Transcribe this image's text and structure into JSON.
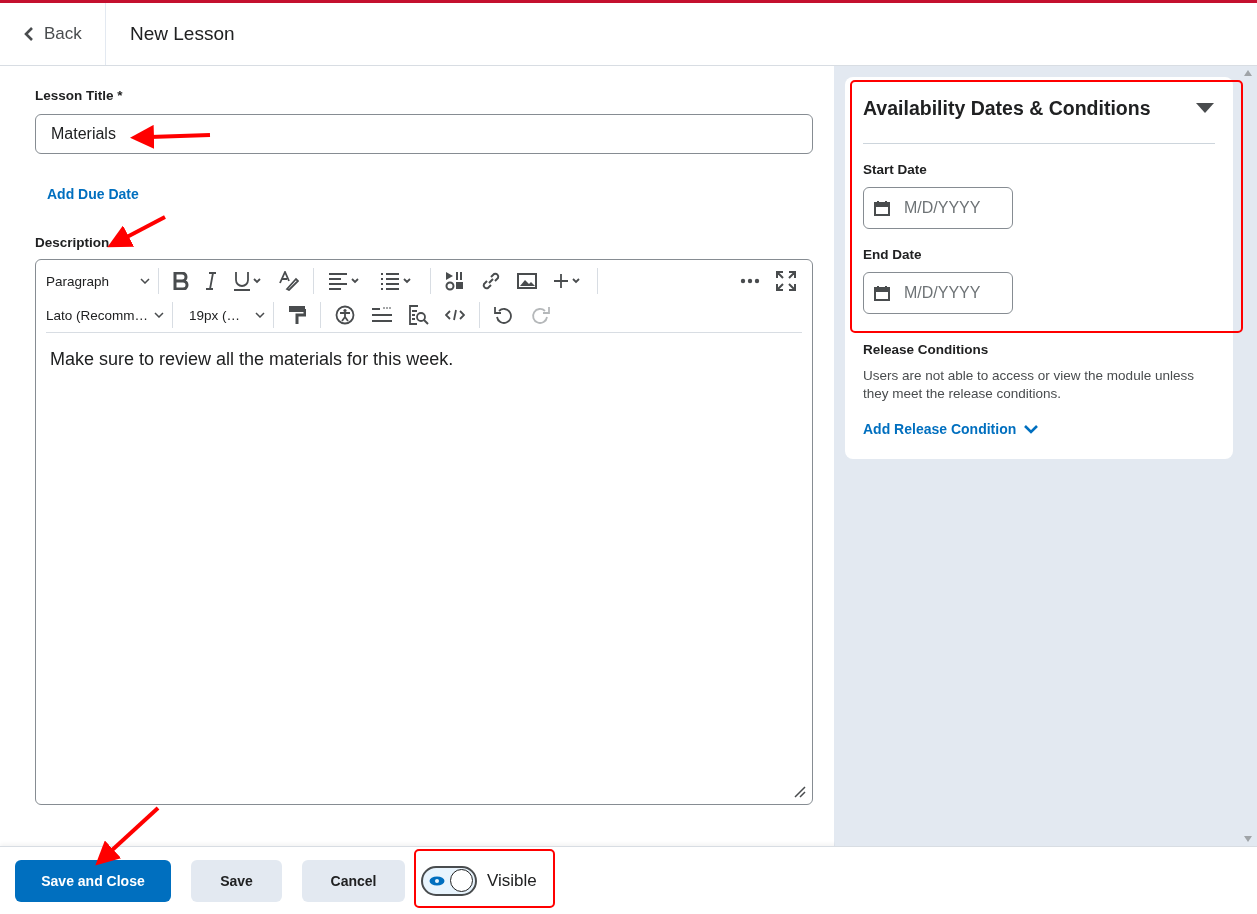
{
  "header": {
    "back": "Back",
    "title": "New Lesson"
  },
  "lesson_title": {
    "label": "Lesson Title *",
    "value": "Materials"
  },
  "add_due_date": "Add Due Date",
  "description": {
    "label": "Description",
    "toolbar_row_1": [
      {
        "kind": "dropdown",
        "label": "Paragraph"
      }
    ],
    "toolbar_row_2": [
      {
        "kind": "dropdown",
        "label": "Lato (Recomm…"
      },
      {
        "kind": "dropdown",
        "label": "19px (…"
      }
    ],
    "text": "Make sure to review all the materials for this week."
  },
  "availability": {
    "title": "Availability Dates & Conditions",
    "expanded": true,
    "fields": [
      {
        "label": "Start Date",
        "placeholder": "M/D/YYYY"
      },
      {
        "label": "End Date",
        "placeholder": "M/D/YYYY"
      }
    ],
    "release_title": "Release Conditions",
    "release_text": "Users are not able to access or view the module unless they meet the release conditions.",
    "add_release": "Add Release Condition"
  },
  "footer": {
    "buttons": [
      {
        "kind": "primary",
        "label": "Save and Close"
      },
      {
        "kind": "secondary",
        "label": "Save"
      },
      {
        "kind": "secondary",
        "label": "Cancel"
      }
    ],
    "visibility": {
      "label": "Visible",
      "on": true
    }
  }
}
